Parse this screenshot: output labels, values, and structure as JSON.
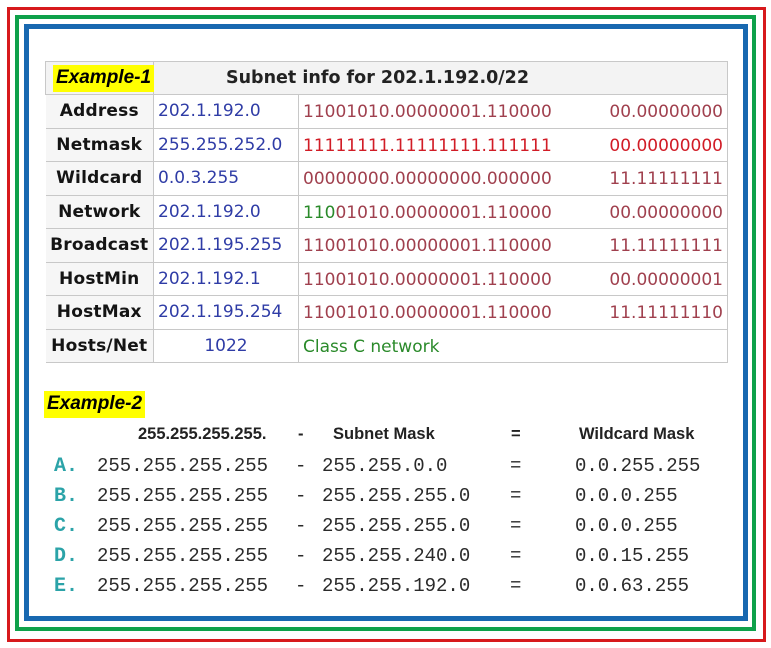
{
  "colors": {
    "frame_outer": "#d7191c",
    "frame_middle": "#0ea14a",
    "frame_inner": "#1868b0",
    "highlight": "#ffff00",
    "ip_text": "#2f3ca6",
    "binary_text": "#a0404e",
    "binary_netmask": "#d11c26",
    "network_prefix": "#2a8a2a",
    "letter_text": "#2ba3a8"
  },
  "example1": {
    "badge": "Example-1",
    "title": "Subnet info for 202.1.192.0/22",
    "rows": [
      {
        "label": "Address",
        "ip": "202.1.192.0",
        "bin_left": "11001010.00000001.110000",
        "bin_right": "00.00000000"
      },
      {
        "label": "Netmask",
        "ip": "255.255.252.0",
        "bin_left": "11111111.11111111.111111",
        "bin_right": "00.00000000"
      },
      {
        "label": "Wildcard",
        "ip": "0.0.3.255",
        "bin_left": "00000000.00000000.000000",
        "bin_right": "11.11111111"
      },
      {
        "label": "Network",
        "ip": "202.1.192.0",
        "bin_prefix": "110",
        "bin_left": "01010.00000001.110000",
        "bin_right": "00.00000000"
      },
      {
        "label": "Broadcast",
        "ip": "202.1.195.255",
        "bin_left": "11001010.00000001.110000",
        "bin_right": "11.11111111"
      },
      {
        "label": "HostMin",
        "ip": "202.1.192.1",
        "bin_left": "11001010.00000001.110000",
        "bin_right": "00.00000001"
      },
      {
        "label": "HostMax",
        "ip": "202.1.195.254",
        "bin_left": "11001010.00000001.110000",
        "bin_right": "11.11111110"
      },
      {
        "label": "Hosts/Net",
        "ip": "1022",
        "note": "Class C network"
      }
    ]
  },
  "example2": {
    "badge": "Example-2",
    "header": {
      "full": "255.255.255.255.",
      "dash": "-",
      "subnet": "Subnet Mask",
      "eq": "=",
      "wildcard": "Wildcard Mask"
    },
    "rows": [
      {
        "letter": "A.",
        "full": "255.255.255.255",
        "dash": "-",
        "mask": "255.255.0.0",
        "eq": "=",
        "wildcard": "0.0.255.255"
      },
      {
        "letter": "B.",
        "full": "255.255.255.255",
        "dash": "-",
        "mask": "255.255.255.0",
        "eq": "=",
        "wildcard": "0.0.0.255"
      },
      {
        "letter": "C.",
        "full": "255.255.255.255",
        "dash": "-",
        "mask": "255.255.255.0",
        "eq": "=",
        "wildcard": "0.0.0.255"
      },
      {
        "letter": "D.",
        "full": "255.255.255.255",
        "dash": "-",
        "mask": "255.255.240.0",
        "eq": "=",
        "wildcard": "0.0.15.255"
      },
      {
        "letter": "E.",
        "full": "255.255.255.255",
        "dash": "-",
        "mask": "255.255.192.0",
        "eq": "=",
        "wildcard": "0.0.63.255"
      }
    ]
  }
}
